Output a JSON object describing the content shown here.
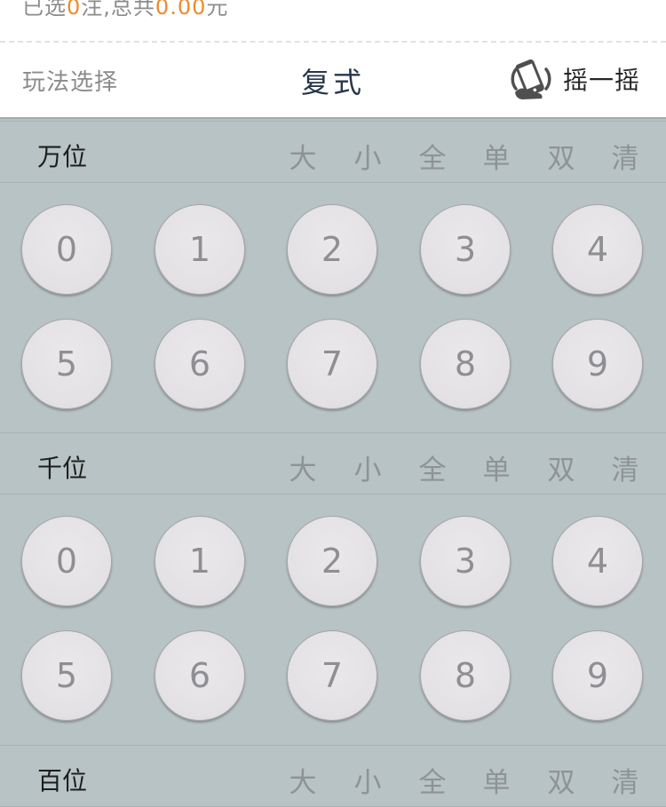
{
  "summary": {
    "prefix": "已选",
    "bet_count": "0",
    "middle": "注,总共",
    "total": "0.00",
    "suffix": "元"
  },
  "header": {
    "play_select": "玩法选择",
    "mode_title": "复式",
    "shake_label": "摇一摇",
    "shake_icon": "phone-shake-icon"
  },
  "quick_select": [
    "大",
    "小",
    "全",
    "单",
    "双",
    "清"
  ],
  "digits": [
    "0",
    "1",
    "2",
    "3",
    "4",
    "5",
    "6",
    "7",
    "8",
    "9"
  ],
  "positions": [
    {
      "name": "万位"
    },
    {
      "name": "千位"
    },
    {
      "name": "百位"
    }
  ],
  "colors": {
    "background": "#b7c3c4",
    "accent": "#ee8a2c",
    "ball": "#e3e1e4",
    "ball_text": "#8f8f93"
  }
}
